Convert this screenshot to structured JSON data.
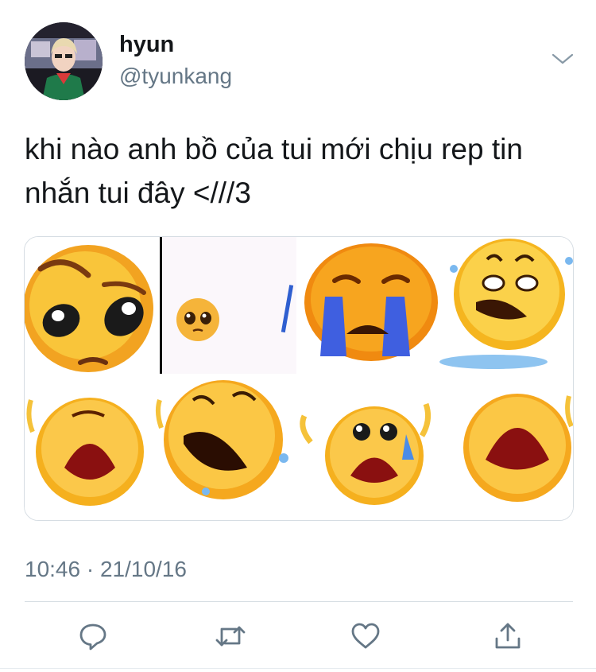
{
  "tweet": {
    "display_name": "hyun",
    "handle": "@tyunkang",
    "text": "khi nào anh bồ của tui mới chịu rep tin nhắn tui đây <///3",
    "timestamp": "10:46 · 21/10/16"
  },
  "media": {
    "description": "crying-emoji-collage"
  },
  "icons": {
    "menu": "chevron-down-icon",
    "reply": "reply-icon",
    "retweet": "retweet-icon",
    "like": "heart-icon",
    "share": "share-icon"
  },
  "colors": {
    "text": "#14171a",
    "secondary": "#657786",
    "border": "#d6dde3",
    "emoji_yellow": "#f7b52c",
    "tear_blue": "#3d7fd9"
  }
}
